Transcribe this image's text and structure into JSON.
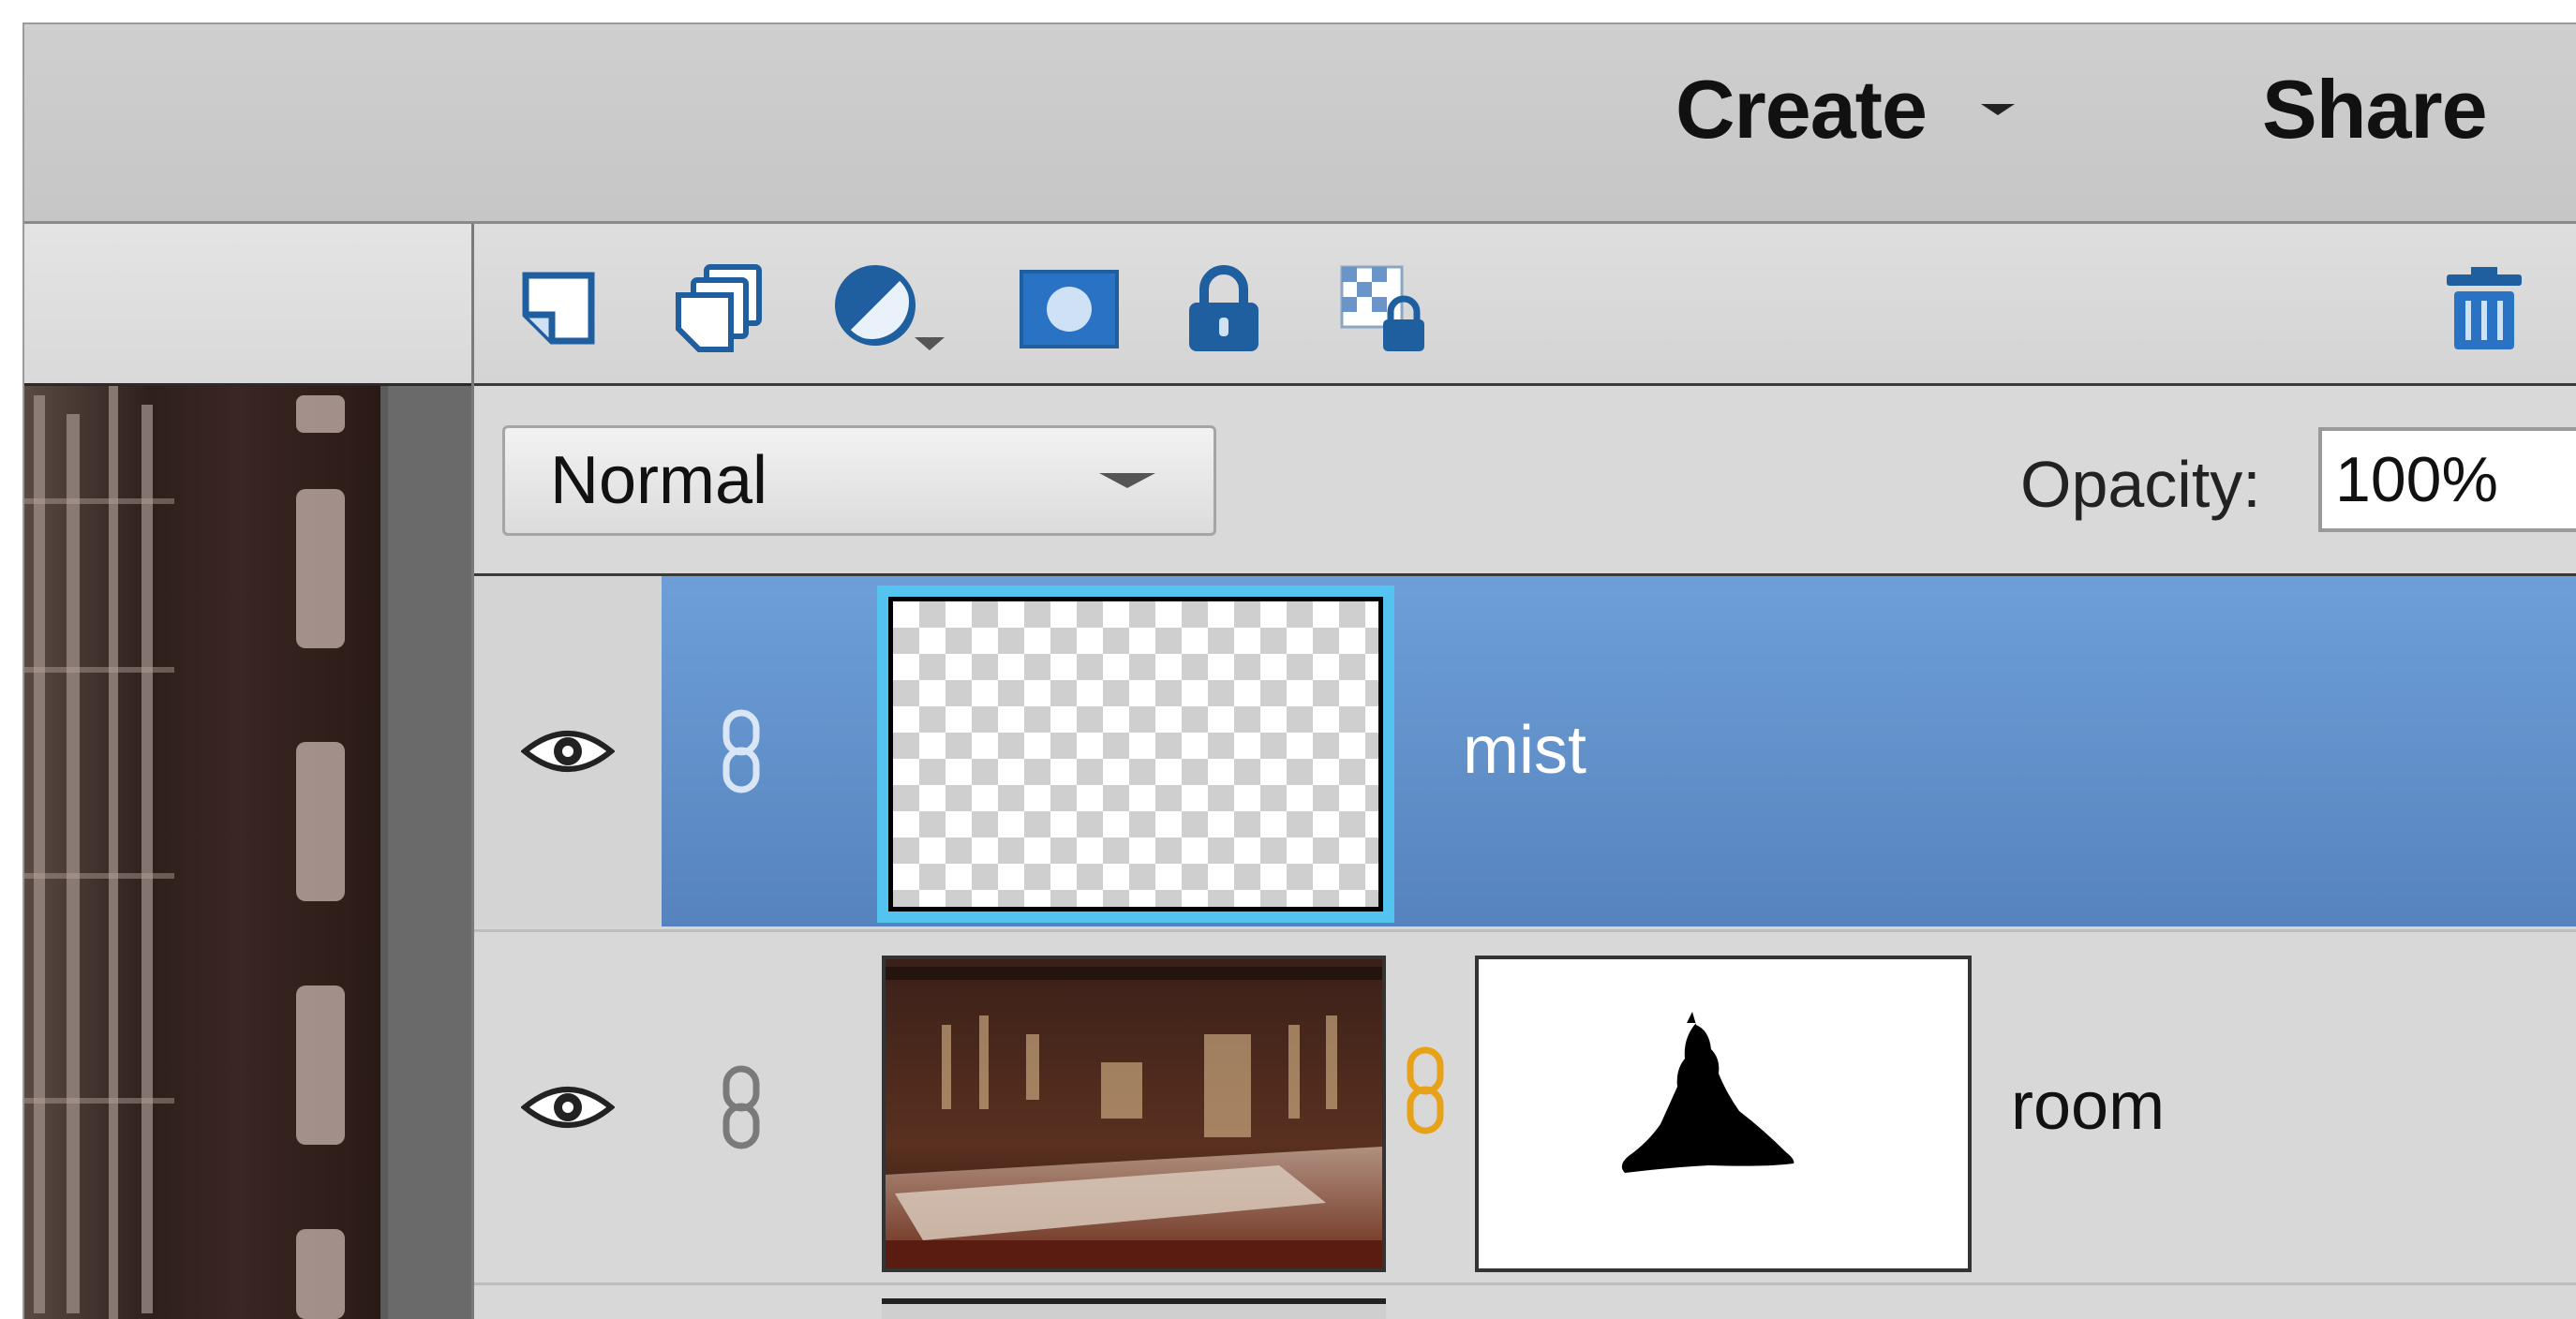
{
  "menubar": {
    "create_label": "Create",
    "share_label": "Share"
  },
  "layers_toolbar": {
    "icons": [
      "new-layer-icon",
      "new-group-icon",
      "adjustment-layer-icon",
      "layer-mask-icon",
      "lock-all-icon",
      "lock-transparent-icon",
      "trash-icon"
    ]
  },
  "blend": {
    "mode": "Normal",
    "opacity_label": "Opacity:",
    "opacity_value": "100%"
  },
  "layers": [
    {
      "name": "mist",
      "selected": true,
      "visible": true
    },
    {
      "name": "room",
      "selected": false,
      "visible": true,
      "has_mask": true
    }
  ],
  "colors": {
    "selection_blue": "#6e9fd8",
    "thumb_highlight": "#52c4ef",
    "mask_link_orange": "#e8a21a"
  }
}
